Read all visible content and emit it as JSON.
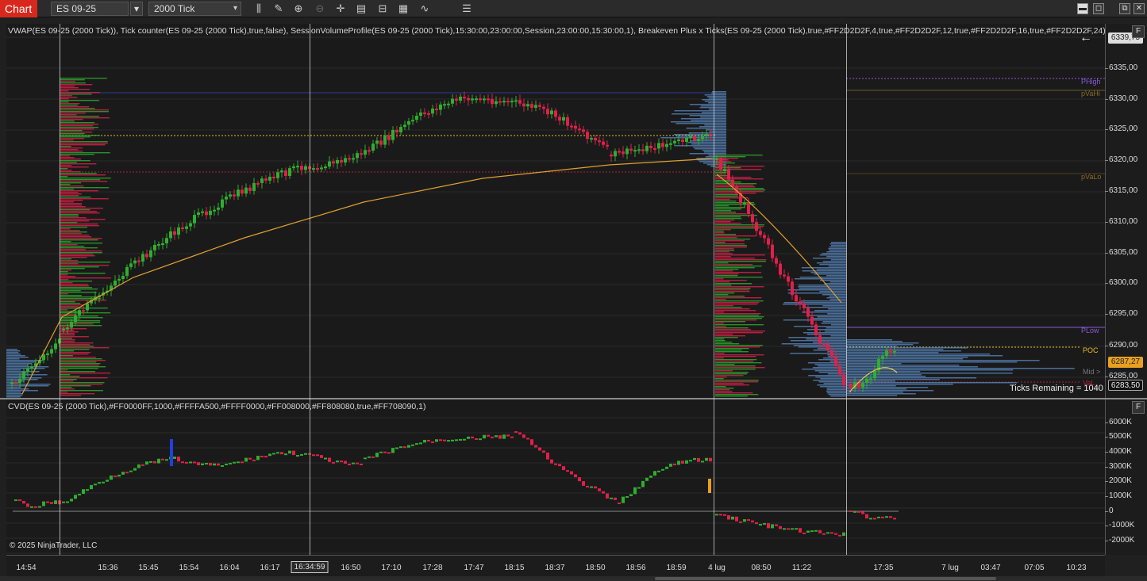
{
  "toolbar": {
    "app_label": "Chart",
    "instrument": "ES 09-25",
    "bar_type": "2000 Tick",
    "tools": [
      "bar-chart-icon",
      "pencil-icon",
      "zoom-in-icon",
      "zoom-out-icon",
      "crosshair-icon",
      "data-box-icon",
      "properties-icon",
      "strategies-icon",
      "indicators-icon",
      "templates-icon"
    ]
  },
  "price_panel": {
    "indicator_label": "VWAP(ES 09-25 (2000 Tick)), Tick counter(ES 09-25 (2000 Tick),true,false), SessionVolumeProfile(ES 09-25 (2000 Tick),15:30:00,23:00:00,Session,23:00:00,15:30:00,1), Breakeven Plus x Ticks(ES 09-25 (2000 Tick),true,#FF2D2D2F,4,true,#FF2D2D2F,12,true,#FF2D2D2F,16,true,#FF2D2D2F,24)",
    "axis_ticks": [
      "6335,00",
      "6330,00",
      "6325,00",
      "6320,00",
      "6315,00",
      "6310,00",
      "6305,00",
      "6300,00",
      "6295,00",
      "6290,00",
      "6285,00"
    ],
    "top_flag": "6339,75",
    "last_price_flag": "6287,27",
    "current_price_flag": "6283,50",
    "ticks_remaining": "Ticks Remaining = 1040",
    "levels": {
      "phigh": "PHigh",
      "pvahi": "pVaHi",
      "pvalo": "pVaLo",
      "plow": "PLow",
      "poc": "POC",
      "mid": "Mid >",
      "val": "VaL"
    }
  },
  "cvd_panel": {
    "indicator_label": "CVD(ES 09-25 (2000 Tick),#FF0000FF,1000,#FFFFA500,#FFFF0000,#FF008000,#FF808080,true,#FF708090,1)",
    "axis_ticks": [
      "6000K",
      "5000K",
      "4000K",
      "3000K",
      "2000K",
      "1000K",
      "0",
      "-1000K",
      "-2000K"
    ],
    "copyright": "© 2025 NinjaTrader, LLC"
  },
  "time_axis": [
    "14:54",
    "15:36",
    "15:45",
    "15:54",
    "16:04",
    "16:17",
    "16:34:59",
    "16:50",
    "17:10",
    "17:28",
    "17:47",
    "18:15",
    "18:37",
    "18:50",
    "18:56",
    "18:59",
    "4 lug",
    "08:50",
    "11:22",
    "17:35",
    "7 lug",
    "03:47",
    "07:05",
    "10:23"
  ],
  "colors": {
    "up": "#2fae2f",
    "down": "#e0204a",
    "vwap": "#e0a030",
    "profile": "#5a8bc4",
    "phigh": "#8a5ad8",
    "plow": "#8a5ad8",
    "poc": "#e8c020",
    "last": "#e8a020"
  }
}
